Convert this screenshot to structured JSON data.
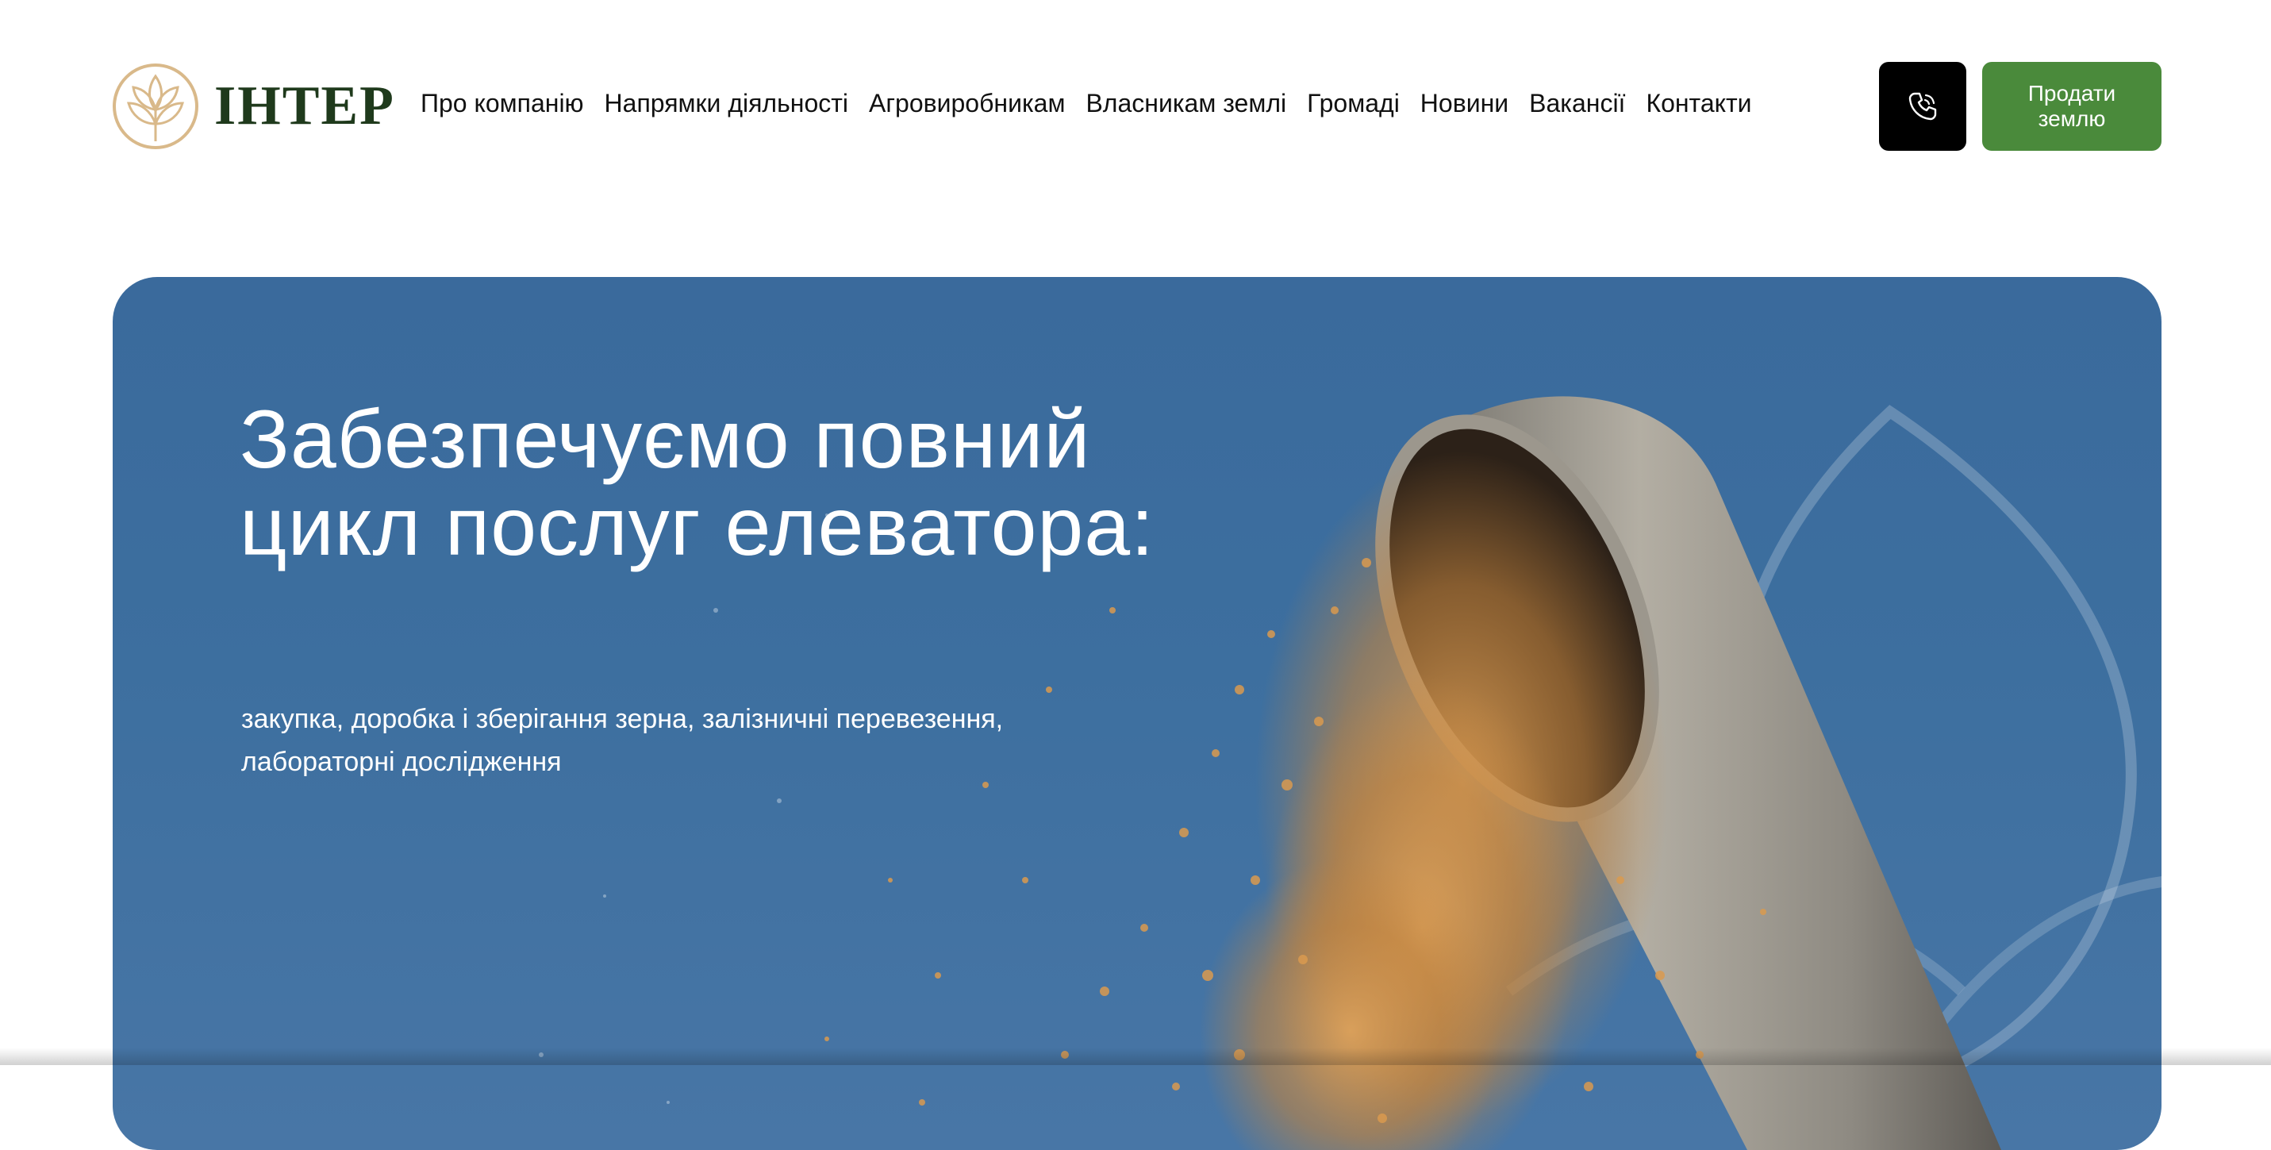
{
  "header": {
    "logo_text": "ІНТЕР",
    "nav": [
      {
        "label": "Про компанію"
      },
      {
        "label": "Напрямки діяльності"
      },
      {
        "label": "Агровиробникам"
      },
      {
        "label": "Власникам землі"
      },
      {
        "label": "Громаді"
      },
      {
        "label": "Новини"
      },
      {
        "label": "Вакансії"
      },
      {
        "label": "Контакти"
      }
    ],
    "phone_icon": "phone-icon",
    "sell_button_label": "Продати землю"
  },
  "hero": {
    "title": "Забезпечуємо повний цикл послуг елеватора:",
    "subtitle": "закупка, доробка і зберігання зерна, залізничні перевезення, лабораторні дослідження"
  },
  "colors": {
    "brand_green": "#4a8a3b",
    "logo_dark_green": "#1f3a1c",
    "logo_gold": "#d9b98a",
    "hero_sky_blue": "#3d6f9f",
    "phone_button_bg": "#000000"
  }
}
